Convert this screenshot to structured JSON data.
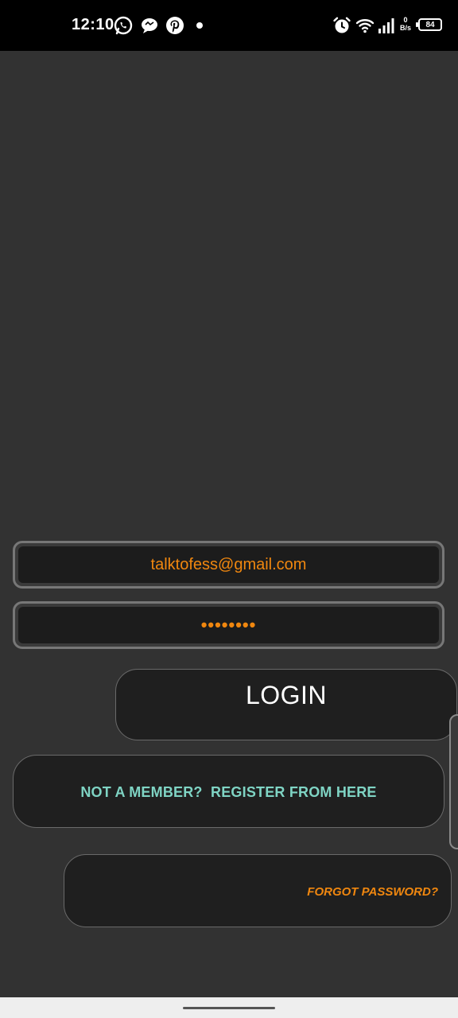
{
  "status_bar": {
    "time": "12:10",
    "notification_icons": [
      "whatsapp-icon",
      "chat-bubble-icon",
      "pinterest-icon"
    ],
    "system_icons": [
      "alarm-icon",
      "wifi-icon",
      "signal-icon"
    ],
    "net_speed_value": "0",
    "net_speed_unit": "B/s",
    "battery_level": "84"
  },
  "login_form": {
    "email_value": "talktofess@gmail.com",
    "password_value": "••••••••",
    "login_label": "LOGIN",
    "register_label": "NOT A MEMBER?  REGISTER FROM HERE",
    "forgot_label": "FORGOT PASSWORD?"
  },
  "colors": {
    "background": "#323232",
    "field_bg": "#1c1c1c",
    "accent_orange": "#f0870f",
    "accent_teal": "#7fd4c4",
    "status_bar": "#000000"
  }
}
